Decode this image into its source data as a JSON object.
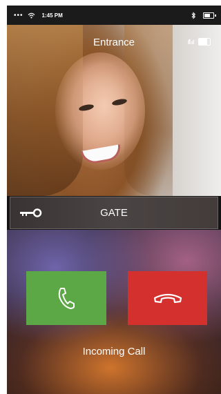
{
  "status_bar": {
    "signal": "•••",
    "time": "1:45 PM"
  },
  "video": {
    "title": "Entrance"
  },
  "gate": {
    "label": "GATE"
  },
  "call": {
    "status": "Incoming Call"
  },
  "colors": {
    "accept": "#5ca846",
    "decline": "#d4312e",
    "gate_bar": "#433c3a"
  },
  "icons": {
    "status": [
      "wifi-icon",
      "bluetooth-icon",
      "battery-icon"
    ],
    "video": [
      "microphone-icon",
      "battery-icon"
    ],
    "gate": "key-icon",
    "accept": "phone-icon",
    "decline": "hang-up-icon"
  }
}
